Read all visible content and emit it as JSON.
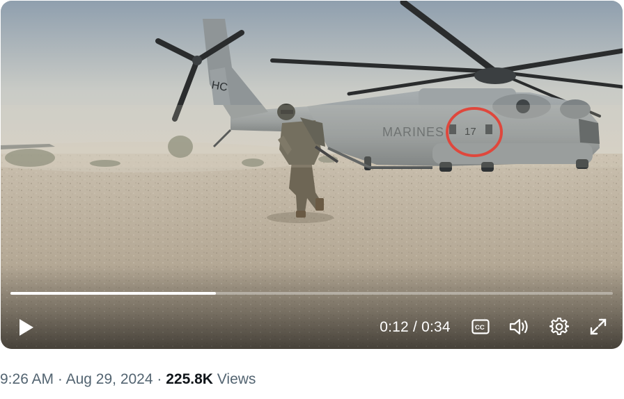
{
  "video": {
    "scene": "helicopter-scene",
    "aircraft_text": {
      "marking": "MARINES",
      "number": "17",
      "tail": "HC"
    },
    "progress_fraction": 0.3415,
    "time_current": "0:12",
    "time_separator": "/",
    "time_total": "0:34",
    "highlight_color": "#e0281e"
  },
  "controls": {
    "play_icon": "play-icon",
    "cc_icon": "closed-captions-icon",
    "volume_icon": "volume-icon",
    "settings_icon": "gear-icon",
    "fullscreen_icon": "fullscreen-icon"
  },
  "meta": {
    "time": "9:26 AM",
    "separator": "·",
    "date": "Aug 29, 2024",
    "views_count": "225.8K",
    "views_label": "Views"
  },
  "colors": {
    "meta_gray": "#536471",
    "text_dark": "#0f1419"
  }
}
